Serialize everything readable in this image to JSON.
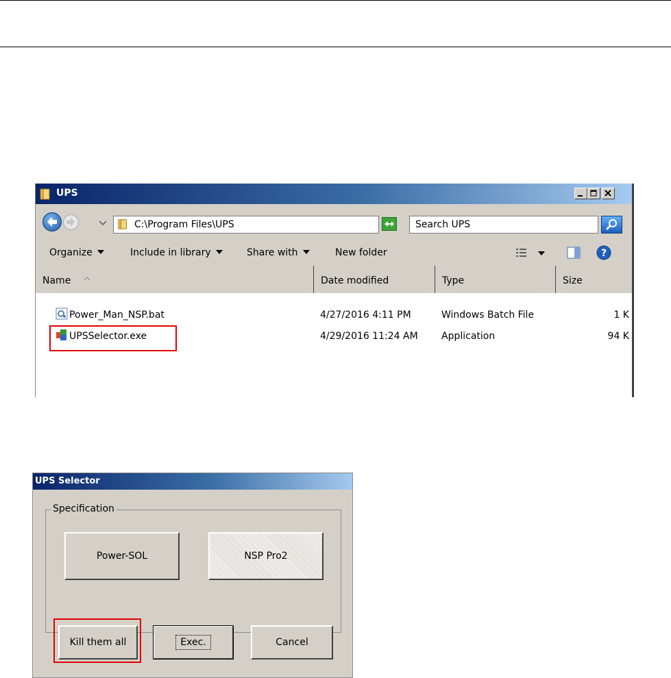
{
  "explorer": {
    "title": "UPS",
    "address": "C:\\Program Files\\UPS",
    "search_placeholder": "Search UPS",
    "toolbar": {
      "organize": "Organize",
      "include_in_library": "Include in library",
      "share_with": "Share with",
      "new_folder": "New folder"
    },
    "columns": {
      "name": "Name",
      "date_modified": "Date modified",
      "type": "Type",
      "size": "Size"
    },
    "files": [
      {
        "name": "Power_Man_NSP.bat",
        "date": "4/27/2016 4:11 PM",
        "type": "Windows Batch File",
        "size": "1 K"
      },
      {
        "name": "UPSSelector.exe",
        "date": "4/29/2016 11:24 AM",
        "type": "Application",
        "size": "94 K"
      }
    ]
  },
  "dialog": {
    "title": "UPS Selector",
    "group_label": "Specification",
    "buttons": {
      "power_sol": "Power-SOL",
      "nsp_pro2": "NSP Pro2",
      "kill_them_all": "Kill them all",
      "exec": "Exec.",
      "cancel": "Cancel"
    }
  },
  "colors": {
    "highlight": "#e00000",
    "titlebar_start": "#0a246a",
    "titlebar_end": "#a6caf0",
    "window_face": "#d4d0c8"
  }
}
